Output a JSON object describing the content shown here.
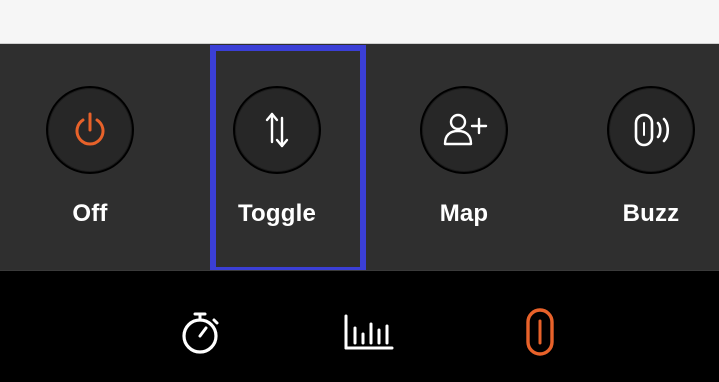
{
  "actions": [
    {
      "id": "off",
      "label": "Off",
      "icon": "power-icon",
      "color": "#e8622a"
    },
    {
      "id": "toggle",
      "label": "Toggle",
      "icon": "swap-vertical-icon",
      "color": "#ffffff"
    },
    {
      "id": "map",
      "label": "Map",
      "icon": "add-person-icon",
      "color": "#ffffff"
    },
    {
      "id": "buzz",
      "label": "Buzz",
      "icon": "device-vibrate-icon",
      "color": "#ffffff"
    }
  ],
  "tabs": [
    {
      "id": "timer",
      "icon": "stopwatch-icon",
      "color": "#ffffff",
      "active": false
    },
    {
      "id": "stats",
      "icon": "bar-chart-icon",
      "color": "#ffffff",
      "active": false
    },
    {
      "id": "device",
      "icon": "device-icon",
      "color": "#e8622a",
      "active": true
    }
  ],
  "colors": {
    "accent": "#e8622a",
    "highlight_border": "#3b3fd6",
    "panel_bg": "#2f2f2f",
    "tab_bg": "#000000"
  }
}
